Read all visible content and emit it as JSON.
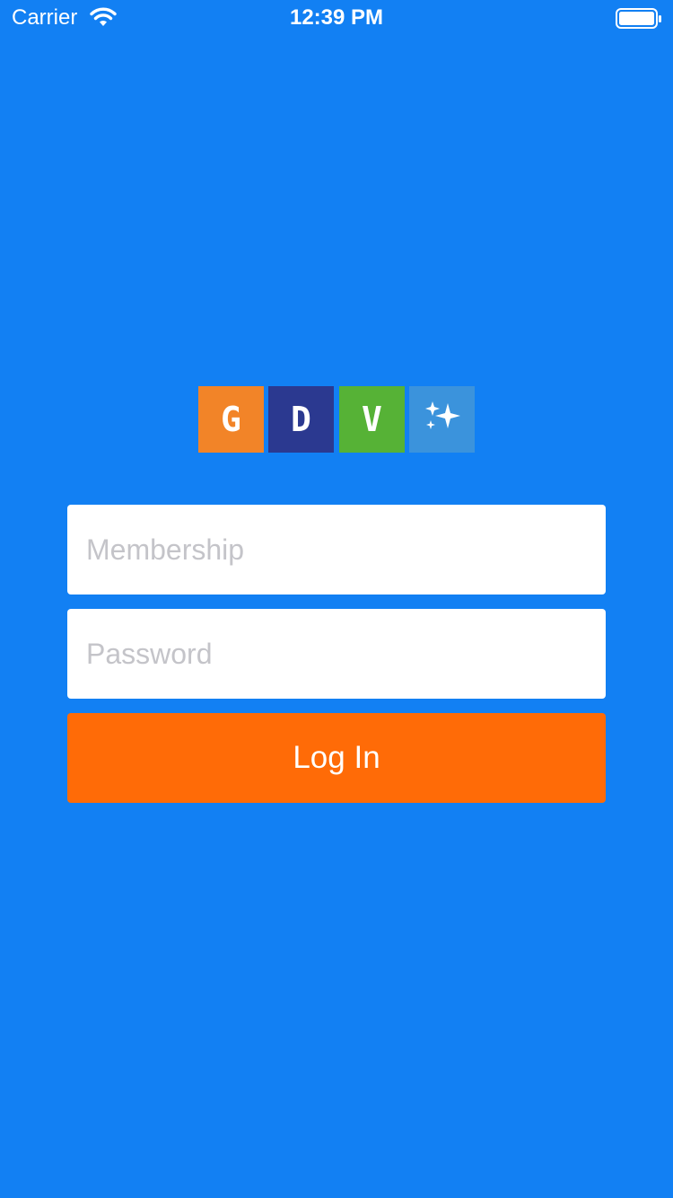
{
  "status_bar": {
    "carrier": "Carrier",
    "time": "12:39 PM",
    "icons": [
      "wifi-icon",
      "battery-icon"
    ]
  },
  "logo": {
    "tiles": [
      {
        "letter": "G",
        "color": "#f28428"
      },
      {
        "letter": "D",
        "color": "#2b3990"
      },
      {
        "letter": "V",
        "color": "#56b236"
      },
      {
        "icon": "sparkles-icon",
        "color": "#3b93dc"
      }
    ]
  },
  "form": {
    "membership_placeholder": "Membership",
    "password_placeholder": "Password",
    "login_label": "Log In"
  },
  "colors": {
    "background": "#1280f3",
    "login_button": "#ff6b07",
    "placeholder_text": "#c4c4c9"
  }
}
